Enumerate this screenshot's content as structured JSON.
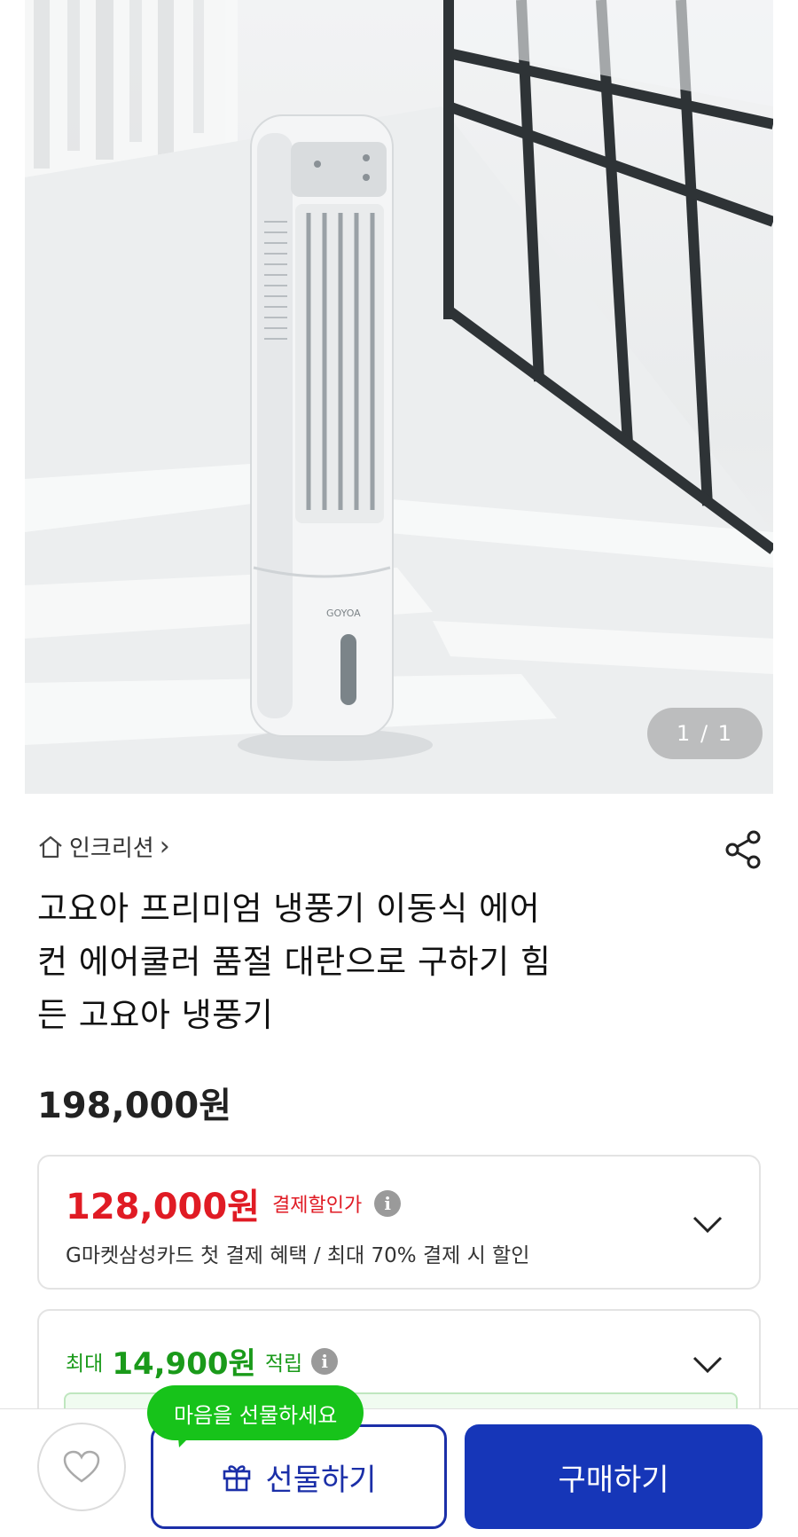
{
  "gallery": {
    "counter": "1 / 1",
    "product_logo": "GOYOA"
  },
  "category": {
    "home_icon": "home-icon",
    "label": "인크리션",
    "chevron": "›"
  },
  "product": {
    "title_lines": [
      "고요아 프리미엄 냉풍기 이동식 에어",
      "컨 에어쿨러 품절 대란으로 구하기 힘",
      "든 고요아 냉풍기"
    ],
    "original_price": "198,000원"
  },
  "discount": {
    "price": "128,000원",
    "label": "결제할인가",
    "description": "G마켓삼성카드 첫 결제 혜택 / 최대 70% 결제 시 할인"
  },
  "reward": {
    "prefix": "최대",
    "amount": "14,900원",
    "suffix": "적립"
  },
  "bottom_bar": {
    "tooltip": "마음을 선물하세요",
    "gift_label": "선물하기",
    "buy_label": "구매하기"
  },
  "colors": {
    "discount_red": "#e01b24",
    "reward_green": "#1a9a1a",
    "tooltip_green": "#17c31a",
    "primary_blue": "#1636b8"
  }
}
